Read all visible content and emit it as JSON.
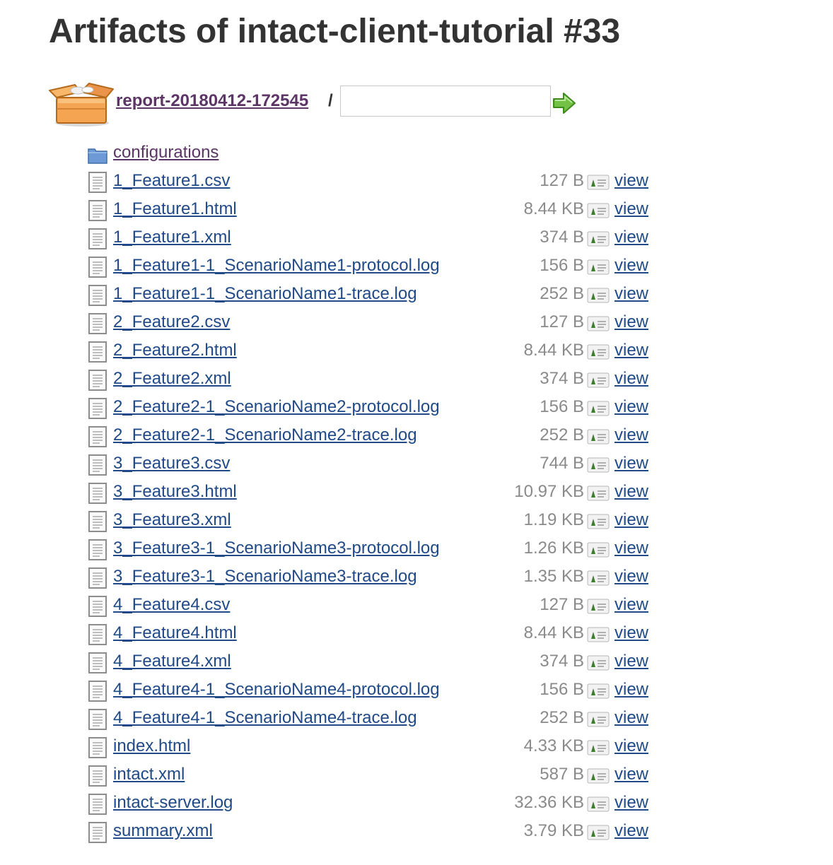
{
  "page": {
    "title": "Artifacts of intact-client-tutorial #33"
  },
  "breadcrumb": {
    "root_label": "report-20180412-172545",
    "separator": "/",
    "path_input_value": ""
  },
  "listing": {
    "view_label": "view",
    "folders": [
      {
        "name": "configurations"
      }
    ],
    "files": [
      {
        "name": "1_Feature1.csv",
        "size": "127 B"
      },
      {
        "name": "1_Feature1.html",
        "size": "8.44 KB"
      },
      {
        "name": "1_Feature1.xml",
        "size": "374 B"
      },
      {
        "name": "1_Feature1-1_ScenarioName1-protocol.log",
        "size": "156 B"
      },
      {
        "name": "1_Feature1-1_ScenarioName1-trace.log",
        "size": "252 B"
      },
      {
        "name": "2_Feature2.csv",
        "size": "127 B"
      },
      {
        "name": "2_Feature2.html",
        "size": "8.44 KB"
      },
      {
        "name": "2_Feature2.xml",
        "size": "374 B"
      },
      {
        "name": "2_Feature2-1_ScenarioName2-protocol.log",
        "size": "156 B"
      },
      {
        "name": "2_Feature2-1_ScenarioName2-trace.log",
        "size": "252 B"
      },
      {
        "name": "3_Feature3.csv",
        "size": "744 B"
      },
      {
        "name": "3_Feature3.html",
        "size": "10.97 KB"
      },
      {
        "name": "3_Feature3.xml",
        "size": "1.19 KB"
      },
      {
        "name": "3_Feature3-1_ScenarioName3-protocol.log",
        "size": "1.26 KB"
      },
      {
        "name": "3_Feature3-1_ScenarioName3-trace.log",
        "size": "1.35 KB"
      },
      {
        "name": "4_Feature4.csv",
        "size": "127 B"
      },
      {
        "name": "4_Feature4.html",
        "size": "8.44 KB"
      },
      {
        "name": "4_Feature4.xml",
        "size": "374 B"
      },
      {
        "name": "4_Feature4-1_ScenarioName4-protocol.log",
        "size": "156 B"
      },
      {
        "name": "4_Feature4-1_ScenarioName4-trace.log",
        "size": "252 B"
      },
      {
        "name": "index.html",
        "size": "4.33 KB"
      },
      {
        "name": "intact.xml",
        "size": "587 B"
      },
      {
        "name": "intact-server.log",
        "size": "32.36 KB"
      },
      {
        "name": "summary.xml",
        "size": "3.79 KB"
      }
    ]
  },
  "colors": {
    "link": "#204a87",
    "visited_link": "#5c3566",
    "size_text": "#8a8a8a",
    "heading": "#333333"
  },
  "icons": {
    "breadcrumb": "package-box-icon",
    "go": "go-arrow-icon",
    "folder": "folder-icon",
    "file": "text-file-icon",
    "view": "fingerprint-view-icon"
  }
}
